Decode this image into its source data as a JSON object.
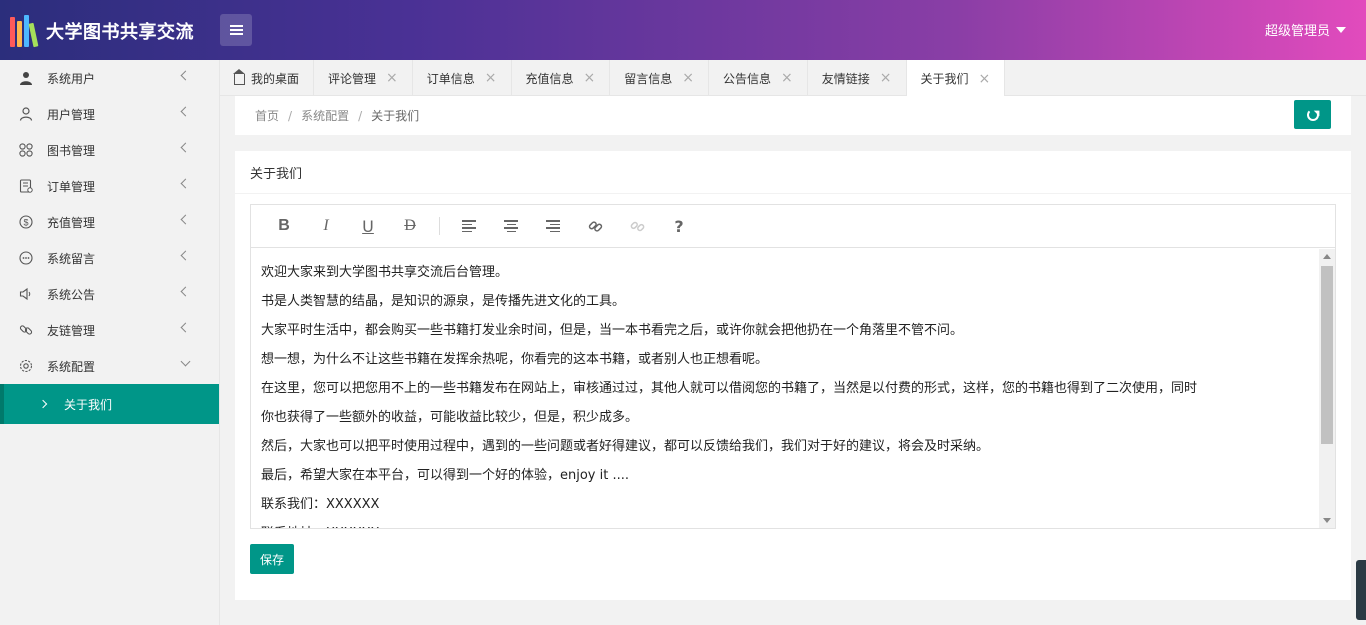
{
  "app": {
    "title": "大学图书共享交流",
    "user": "超级管理员",
    "logo_colors": [
      "#ff5a5a",
      "#ffb84d",
      "#4db8ff",
      "#a6e05a",
      "#e05aff"
    ]
  },
  "sidebar": {
    "items": [
      {
        "label": "系统用户",
        "icon": "user-filled-icon"
      },
      {
        "label": "用户管理",
        "icon": "user-icon"
      },
      {
        "label": "图书管理",
        "icon": "grid-icon"
      },
      {
        "label": "订单管理",
        "icon": "order-icon"
      },
      {
        "label": "充值管理",
        "icon": "dollar-icon"
      },
      {
        "label": "系统留言",
        "icon": "message-icon"
      },
      {
        "label": "系统公告",
        "icon": "speaker-icon"
      },
      {
        "label": "友链管理",
        "icon": "link-icon"
      },
      {
        "label": "系统配置",
        "icon": "gear-icon"
      }
    ],
    "sub_item": "关于我们"
  },
  "tabs": [
    {
      "label": "我的桌面",
      "closable": false
    },
    {
      "label": "评论管理",
      "closable": true
    },
    {
      "label": "订单信息",
      "closable": true
    },
    {
      "label": "充值信息",
      "closable": true
    },
    {
      "label": "留言信息",
      "closable": true
    },
    {
      "label": "公告信息",
      "closable": true
    },
    {
      "label": "友情链接",
      "closable": true
    },
    {
      "label": "关于我们",
      "closable": true,
      "active": true
    }
  ],
  "breadcrumb": [
    "首页",
    "系统配置",
    "关于我们"
  ],
  "card": {
    "title": "关于我们",
    "save_label": "保存",
    "toolbar_help": "?"
  },
  "content": [
    "欢迎大家来到大学图书共享交流后台管理。",
    "书是人类智慧的结晶，是知识的源泉，是传播先进文化的工具。",
    "大家平时生活中，都会购买一些书籍打发业余时间，但是，当一本书看完之后，或许你就会把他扔在一个角落里不管不问。",
    "想一想，为什么不让这些书籍在发挥余热呢，你看完的这本书籍，或者别人也正想看呢。",
    "在这里，您可以把您用不上的一些书籍发布在网站上，审核通过过，其他人就可以借阅您的书籍了，当然是以付费的形式，这样，您的书籍也得到了二次使用，同时",
    "你也获得了一些额外的收益，可能收益比较少，但是，积少成多。",
    "然后，大家也可以把平时使用过程中，遇到的一些问题或者好得建议，都可以反馈给我们，我们对于好的建议，将会及时采纳。",
    "最后，希望大家在本平台，可以得到一个好的体验，enjoy it ....",
    "联系我们：XXXXXX",
    "联系地址：XXXXXX"
  ],
  "colors": {
    "accent": "#009688"
  }
}
